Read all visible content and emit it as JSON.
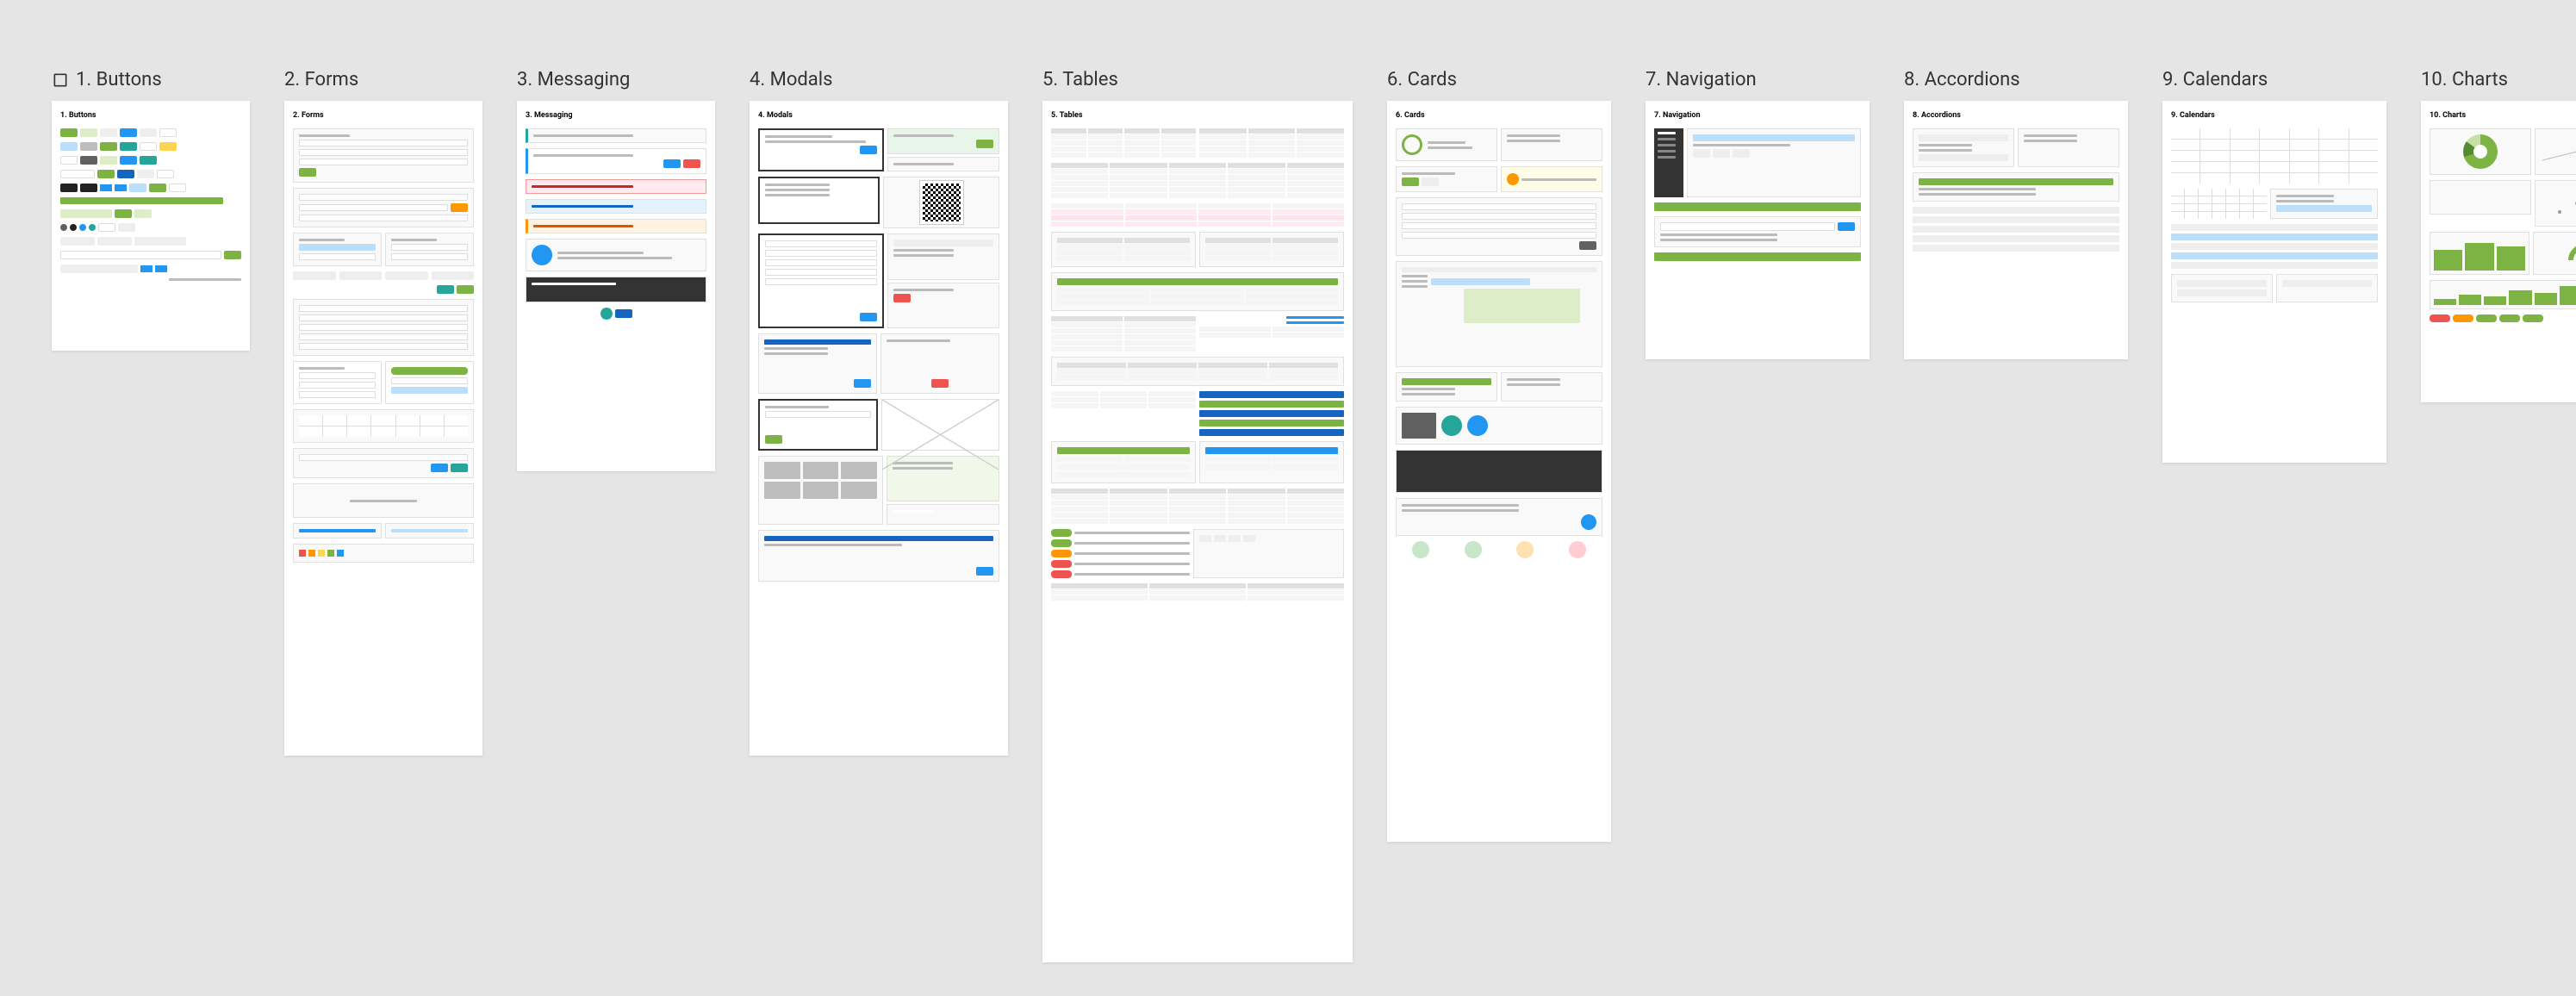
{
  "frames": [
    {
      "label": "1. Buttons",
      "title": "1. Buttons"
    },
    {
      "label": "2. Forms",
      "title": "2. Forms"
    },
    {
      "label": "3. Messaging",
      "title": "3. Messaging"
    },
    {
      "label": "4. Modals",
      "title": "4. Modals"
    },
    {
      "label": "5. Tables",
      "title": "5. Tables"
    },
    {
      "label": "6. Cards",
      "title": "6. Cards"
    },
    {
      "label": "7. Navigation",
      "title": "7. Navigation"
    },
    {
      "label": "8. Accordions",
      "title": "8. Accordions"
    },
    {
      "label": "9. Calendars",
      "title": "9. Calendars"
    },
    {
      "label": "10. Charts",
      "title": "10. Charts"
    }
  ],
  "icons": {
    "frame": "frame-icon"
  }
}
